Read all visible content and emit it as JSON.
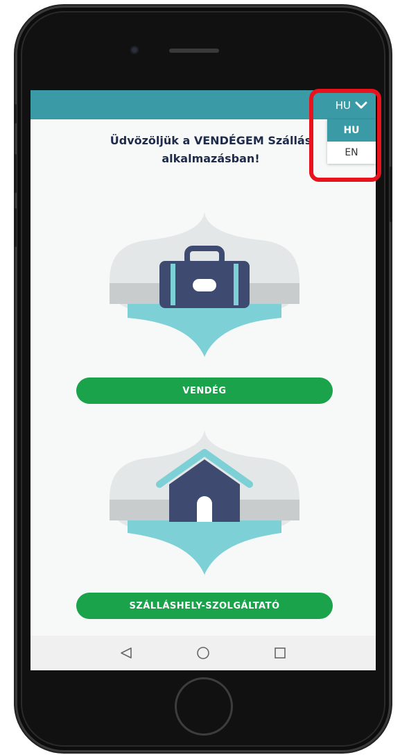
{
  "header": {
    "language_selected": "HU"
  },
  "language_menu": {
    "items": [
      {
        "label": "HU",
        "active": true
      },
      {
        "label": "EN",
        "active": false
      }
    ]
  },
  "welcome": {
    "line1": "Üdvözöljük a VENDÉGEM Szállás",
    "line2": "alkalmazásban!"
  },
  "buttons": {
    "guest": "VENDÉG",
    "provider": "SZÁLLÁSHELY-SZOLGÁLTATÓ"
  },
  "icons": {
    "guest_illustration": "suitcase-icon",
    "provider_illustration": "house-icon",
    "nav_back": "triangle-back-icon",
    "nav_home": "circle-home-icon",
    "nav_recents": "square-recents-icon"
  },
  "colors": {
    "topbar": "#3a9aa6",
    "button": "#1aa34a",
    "title_text": "#1f2b4a",
    "highlight": "#e8131c",
    "illustration_dark": "#3e4a6f",
    "illustration_accent": "#7dd0d6"
  }
}
